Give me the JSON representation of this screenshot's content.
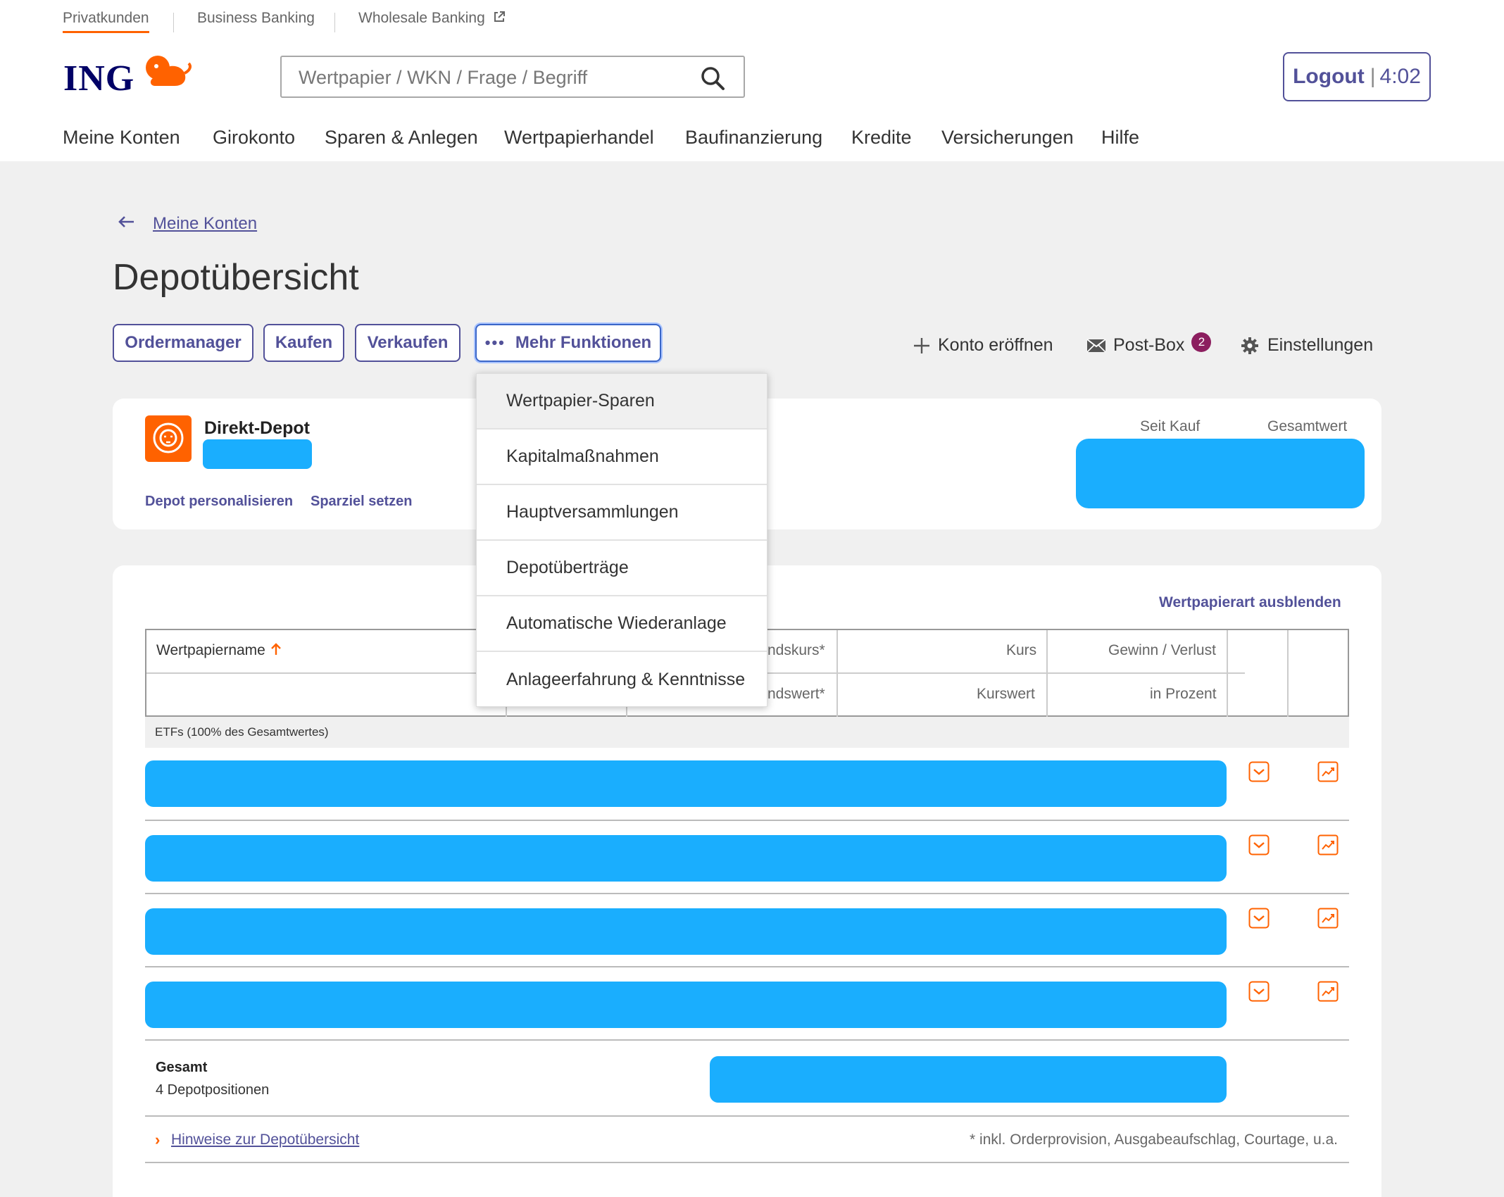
{
  "segments": [
    {
      "label": "Privatkunden"
    },
    {
      "label": "Business Banking"
    },
    {
      "label": "Wholesale Banking"
    }
  ],
  "brand": {
    "name": "ING",
    "accent": "#ff6200",
    "primary": "#525199",
    "navy": "#000066"
  },
  "search": {
    "placeholder": "Wertpapier / WKN / Frage / Begriff"
  },
  "logout": {
    "label": "Logout",
    "separator": "|",
    "timer": "4:02"
  },
  "nav": [
    "Meine Konten",
    "Girokonto",
    "Sparen & Anlegen",
    "Wertpapierhandel",
    "Baufinanzierung",
    "Kredite",
    "Versicherungen",
    "Hilfe"
  ],
  "breadcrumb": {
    "back_label": "Meine Konten"
  },
  "page": {
    "title": "Depotübersicht"
  },
  "buttons": {
    "ordermanager": "Ordermanager",
    "kaufen": "Kaufen",
    "verkaufen": "Verkaufen",
    "mehr_dots": "•••",
    "mehr": "Mehr Funktionen"
  },
  "actions": {
    "konto_eroeffnen": "Konto eröffnen",
    "postbox": "Post-Box",
    "postbox_count": "2",
    "einstellungen": "Einstellungen"
  },
  "depot": {
    "name": "Direkt-Depot",
    "link_personalize": "Depot personalisieren",
    "link_goal": "Sparziel setzen",
    "col_seit_kauf": "Seit Kauf",
    "col_gesamtwert": "Gesamtwert"
  },
  "table": {
    "hide_type_link": "Wertpapierart ausblenden",
    "col_name": "Wertpapiername",
    "col_einstandskurs_partial": "ndskurs*",
    "col_einstandswert_partial": "ndswert*",
    "col_kurs": "Kurs",
    "col_kurswert": "Kurswert",
    "col_gewinn": "Gewinn / Verlust",
    "col_prozent": "in Prozent",
    "group_label": "ETFs (100% des Gesamtwertes)",
    "total_label": "Gesamt",
    "total_positions": "4 Depotpositionen"
  },
  "footer": {
    "chevron": "›",
    "hint_link": "Hinweise zur Depotübersicht",
    "footnote": "* inkl. Orderprovision, Ausgabeaufschlag, Courtage, u.a."
  },
  "dropdown": {
    "items": [
      {
        "label": "Wertpapier-Sparen"
      },
      {
        "label": "Kapitalmaßnahmen"
      },
      {
        "label": "Hauptversammlungen"
      },
      {
        "label": "Depotüberträge"
      },
      {
        "label": "Automatische Wiederanlage"
      },
      {
        "label": "Anlageerfahrung & Kenntnisse"
      }
    ]
  }
}
